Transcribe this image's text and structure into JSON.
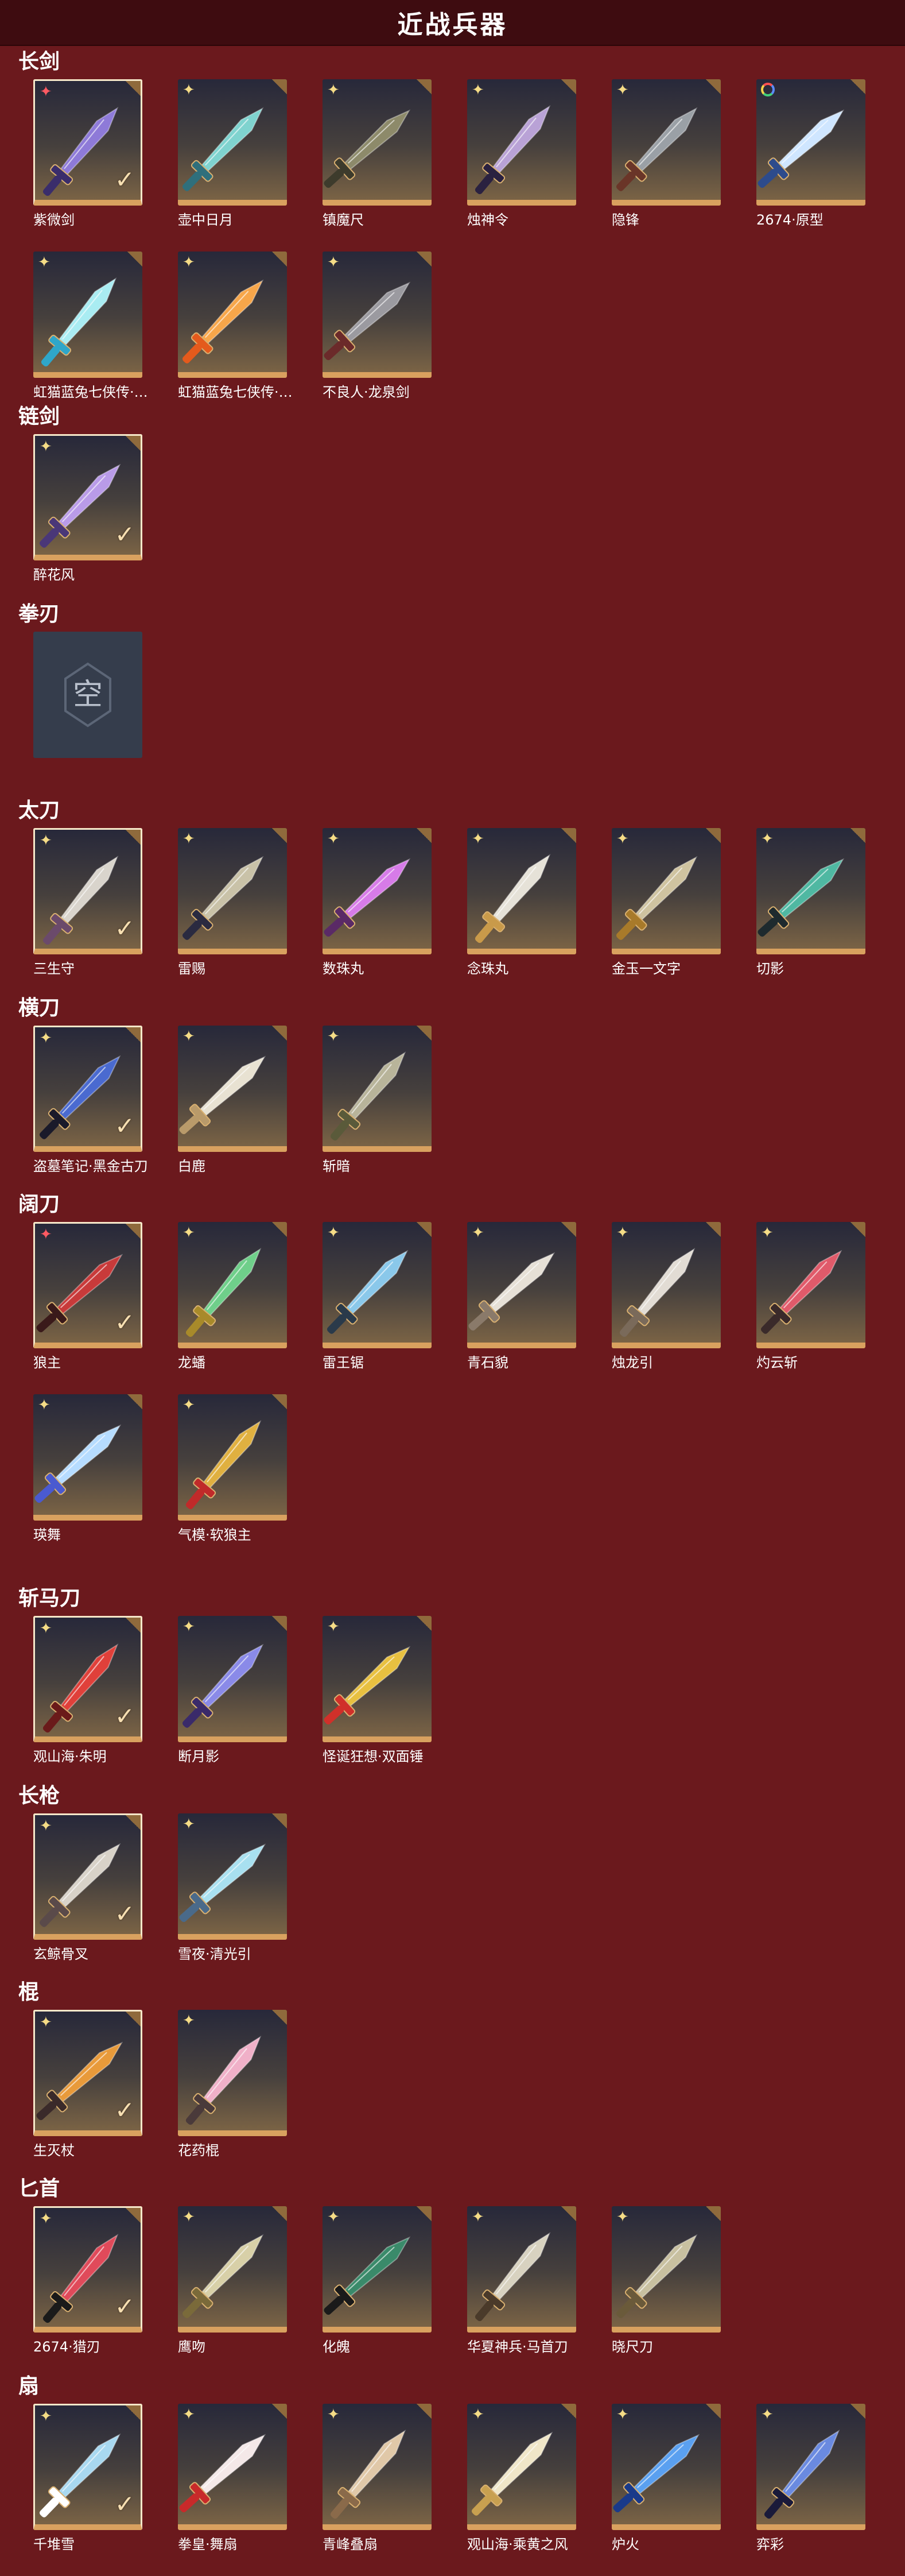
{
  "header": {
    "title": "近战兵器"
  },
  "check_glyph": "✓",
  "empty_label": "空",
  "sections": [
    {
      "title": "长剑",
      "items": [
        {
          "name": "紫微剑",
          "rarity": "red",
          "equipped": true,
          "blade": "#8e7ad8",
          "accent": "#3a2d6b"
        },
        {
          "name": "壶中日月",
          "rarity": "gold",
          "equipped": false,
          "blade": "#7fd3cf",
          "accent": "#2f6f7c"
        },
        {
          "name": "镇魔尺",
          "rarity": "gold",
          "equipped": false,
          "blade": "#8d8a6a",
          "accent": "#3d3b2c"
        },
        {
          "name": "烛神令",
          "rarity": "gold",
          "equipped": false,
          "blade": "#b9a2d6",
          "accent": "#2a2140"
        },
        {
          "name": "隐锋",
          "rarity": "gold",
          "equipped": false,
          "blade": "#9aa0a6",
          "accent": "#6a3528"
        },
        {
          "name": "2674·原型",
          "rarity": "rainbow",
          "equipped": false,
          "blade": "#cfe6ff",
          "accent": "#2d4b8c"
        },
        {
          "name": "虹猫蓝兔七侠传·冰魄剑",
          "rarity": "gold",
          "equipped": false,
          "blade": "#a9ecf2",
          "accent": "#2fa6c9"
        },
        {
          "name": "虹猫蓝兔七侠传·长虹剑",
          "rarity": "gold",
          "equipped": false,
          "blade": "#f7a64a",
          "accent": "#e45a1c"
        },
        {
          "name": "不良人·龙泉剑",
          "rarity": "gold",
          "equipped": false,
          "blade": "#9b9aa0",
          "accent": "#6b2a2a"
        }
      ]
    },
    {
      "title": "链剑",
      "items": [
        {
          "name": "醉花风",
          "rarity": "gold",
          "equipped": true,
          "blade": "#b99be8",
          "accent": "#4a3778"
        }
      ]
    },
    {
      "title": "拳刃",
      "items": [
        {
          "name": "",
          "empty": true
        }
      ]
    },
    {
      "title": "太刀",
      "items": [
        {
          "name": "三生守",
          "rarity": "gold",
          "equipped": true,
          "blade": "#d9d4cc",
          "accent": "#6b4a6b"
        },
        {
          "name": "雷赐",
          "rarity": "gold",
          "equipped": false,
          "blade": "#c9c2a8",
          "accent": "#2a2a40"
        },
        {
          "name": "数珠丸",
          "rarity": "gold",
          "equipped": false,
          "blade": "#d77be8",
          "accent": "#5a2a66"
        },
        {
          "name": "念珠丸",
          "rarity": "gold",
          "equipped": false,
          "blade": "#e6e2d8",
          "accent": "#c99a4a"
        },
        {
          "name": "金玉一文字",
          "rarity": "gold",
          "equipped": false,
          "blade": "#cfc3a0",
          "accent": "#a87a2a"
        },
        {
          "name": "切影",
          "rarity": "gold",
          "equipped": false,
          "blade": "#4fb8a2",
          "accent": "#1e2a2e"
        }
      ]
    },
    {
      "title": "横刀",
      "items": [
        {
          "name": "盗墓笔记·黑金古刀",
          "rarity": "gold",
          "equipped": true,
          "blade": "#4a6ad0",
          "accent": "#1a1a2a"
        },
        {
          "name": "白鹿",
          "rarity": "gold",
          "equipped": false,
          "blade": "#e8e2d2",
          "accent": "#b99a6a"
        },
        {
          "name": "斩暗",
          "rarity": "gold",
          "equipped": false,
          "blade": "#b8b49a",
          "accent": "#5a5a3a"
        }
      ]
    },
    {
      "title": "阔刀",
      "items": [
        {
          "name": "狼主",
          "rarity": "red",
          "equipped": true,
          "blade": "#c83a3a",
          "accent": "#3a1a1a"
        },
        {
          "name": "龙蟠",
          "rarity": "gold",
          "equipped": false,
          "blade": "#6fcf8a",
          "accent": "#a88a2a"
        },
        {
          "name": "雷王锯",
          "rarity": "gold",
          "equipped": false,
          "blade": "#8ac8ea",
          "accent": "#2a3a4a"
        },
        {
          "name": "青石貌",
          "rarity": "gold",
          "equipped": false,
          "blade": "#e6e0d6",
          "accent": "#8a7a6a"
        },
        {
          "name": "烛龙引",
          "rarity": "gold",
          "equipped": false,
          "blade": "#e2dcd4",
          "accent": "#7a6a5a"
        },
        {
          "name": "灼云斩",
          "rarity": "gold",
          "equipped": false,
          "blade": "#e05a6a",
          "accent": "#3a2a2a"
        },
        {
          "name": "瑛舞",
          "rarity": "gold",
          "equipped": false,
          "blade": "#b6dcff",
          "accent": "#4a5ad0"
        },
        {
          "name": "气模·软狼主",
          "rarity": "gold",
          "equipped": false,
          "blade": "#e0b040",
          "accent": "#c02a2a"
        }
      ]
    },
    {
      "title": "斩马刀",
      "items": [
        {
          "name": "观山海·朱明",
          "rarity": "gold",
          "equipped": true,
          "blade": "#e0403a",
          "accent": "#6a1a1a"
        },
        {
          "name": "断月影",
          "rarity": "gold",
          "equipped": false,
          "blade": "#8a8ae8",
          "accent": "#3a2a6a"
        },
        {
          "name": "怪诞狂想·双面锤",
          "rarity": "gold",
          "equipped": false,
          "blade": "#e8c040",
          "accent": "#d0302a"
        }
      ]
    },
    {
      "title": "长枪",
      "items": [
        {
          "name": "玄鲸骨叉",
          "rarity": "gold",
          "equipped": true,
          "blade": "#d8d2c8",
          "accent": "#5a4a4a"
        },
        {
          "name": "雪夜·清光引",
          "rarity": "gold",
          "equipped": false,
          "blade": "#a8e0f0",
          "accent": "#4a6a8a"
        }
      ]
    },
    {
      "title": "棍",
      "items": [
        {
          "name": "生灭杖",
          "rarity": "gold",
          "equipped": true,
          "blade": "#e89a3a",
          "accent": "#3a2a2a"
        },
        {
          "name": "花药棍",
          "rarity": "gold",
          "equipped": false,
          "blade": "#f0b0c8",
          "accent": "#4a3a3a"
        }
      ]
    },
    {
      "title": "匕首",
      "items": [
        {
          "name": "2674·猎刃",
          "rarity": "gold",
          "equipped": true,
          "blade": "#e04a5a",
          "accent": "#1a1a1a"
        },
        {
          "name": "鹰吻",
          "rarity": "gold",
          "equipped": false,
          "blade": "#d8d0a8",
          "accent": "#7a6a3a"
        },
        {
          "name": "化魄",
          "rarity": "gold",
          "equipped": false,
          "blade": "#3a8a6a",
          "accent": "#1a1a1a"
        },
        {
          "name": "华夏神兵·马首刀",
          "rarity": "gold",
          "equipped": false,
          "blade": "#d8d2c0",
          "accent": "#4a3a2a"
        },
        {
          "name": "晓尺刀",
          "rarity": "gold",
          "equipped": false,
          "blade": "#c8c0a0",
          "accent": "#6a5a3a"
        }
      ]
    },
    {
      "title": "扇",
      "items": [
        {
          "name": "千堆雪",
          "rarity": "gold",
          "equipped": true,
          "blade": "#a8d8f0",
          "accent": "#ffffff"
        },
        {
          "name": "拳皇·舞扇",
          "rarity": "gold",
          "equipped": false,
          "blade": "#f4e8e8",
          "accent": "#c82a2a"
        },
        {
          "name": "青峰叠扇",
          "rarity": "gold",
          "equipped": false,
          "blade": "#e0c8a8",
          "accent": "#8a6a4a"
        },
        {
          "name": "观山海·乘黄之风",
          "rarity": "gold",
          "equipped": false,
          "blade": "#f0e6c8",
          "accent": "#c8a050"
        },
        {
          "name": "炉火",
          "rarity": "gold",
          "equipped": false,
          "blade": "#5aa0f0",
          "accent": "#1a3a8a"
        },
        {
          "name": "弈彩",
          "rarity": "gold",
          "equipped": false,
          "blade": "#6a8ae0",
          "accent": "#1a1a3a"
        }
      ]
    }
  ]
}
